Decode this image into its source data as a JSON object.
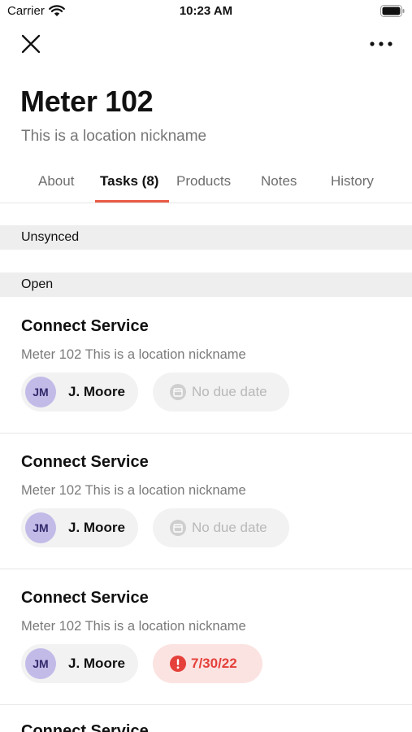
{
  "status_bar": {
    "carrier": "Carrier",
    "time": "10:23 AM"
  },
  "header": {
    "title": "Meter 102",
    "subtitle": "This is a location nickname"
  },
  "tabs": [
    {
      "label": "About"
    },
    {
      "label": "Tasks (8)",
      "active": true
    },
    {
      "label": "Products"
    },
    {
      "label": "Notes"
    },
    {
      "label": "History"
    }
  ],
  "sections": {
    "unsynced": "Unsynced",
    "open": "Open"
  },
  "tasks": [
    {
      "title": "Connect Service",
      "location": "Meter 102 This is a location nickname",
      "assignee_initials": "JM",
      "assignee_name": "J. Moore",
      "due": "No due date",
      "overdue": false
    },
    {
      "title": "Connect Service",
      "location": "Meter 102 This is a location nickname",
      "assignee_initials": "JM",
      "assignee_name": "J. Moore",
      "due": "No due date",
      "overdue": false
    },
    {
      "title": "Connect Service",
      "location": "Meter 102 This is a location nickname",
      "assignee_initials": "JM",
      "assignee_name": "J. Moore",
      "due": "7/30/22",
      "overdue": true
    },
    {
      "title": "Connect Service"
    }
  ],
  "colors": {
    "accent": "#ea5a44",
    "overdue_text": "#e5403a",
    "overdue_bg": "#fbe3e1",
    "avatar_bg": "#c2bbe8",
    "chip_bg": "#f2f2f2",
    "section_bg": "#eeeeee"
  },
  "icons": {
    "close": "close-icon",
    "more": "more-horizontal-icon",
    "calendar": "calendar-icon",
    "alert": "alert-circle-icon"
  }
}
